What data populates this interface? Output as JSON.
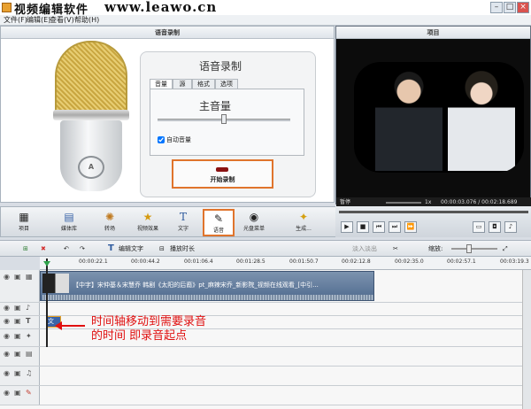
{
  "window": {
    "title": "视频编辑软件",
    "site": "www.leawo.cn"
  },
  "menu": [
    "文件(F)",
    "编辑(E)",
    "查看(V)",
    "帮助(H)"
  ],
  "voice_panel": {
    "header": "语音录制",
    "card_title": "语音录制",
    "tabs": [
      "音量",
      "源",
      "格式",
      "选项"
    ],
    "master_volume": "主音量",
    "auto_volume": "自动音量",
    "auto_volume_checked": true,
    "start_button": "开始录制"
  },
  "project_panel": {
    "header": "项目",
    "status": "暂停",
    "speed": "1x",
    "time": "00:00:03.076 / 00:02:18.689"
  },
  "toolbar": [
    "项目",
    "媒体库",
    "转场",
    "视频效果",
    "文字",
    "语音",
    "光盘菜单",
    "生成..."
  ],
  "timeline_toolbar": {
    "edit_text": "编辑文字",
    "duration": "播放时长",
    "fade": "淡入淡出",
    "zoom": "缩放:"
  },
  "ruler_ticks": [
    "00:00:22.1",
    "00:00:44.2",
    "00:01:06.4",
    "00:01:28.5",
    "00:01:50.7",
    "00:02:12.8",
    "00:02:35.0",
    "00:02:57.1",
    "00:03:19.3"
  ],
  "clip": {
    "title": "【中字】宋仲基＆宋慧乔 韩剧《太阳的后裔》pt_麻辣宋乔_新影院_视频在线观看_[中引..."
  },
  "text_clip": "文",
  "annotation": {
    "line1": "时间轴移动到需要录音",
    "line2": "的时间   即录音起点"
  }
}
